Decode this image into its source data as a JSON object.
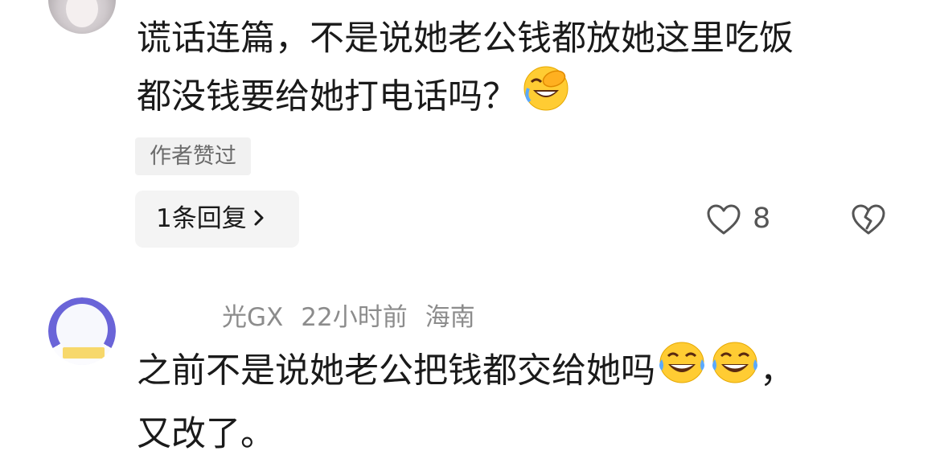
{
  "comment1": {
    "text_line1": "谎话连篇，不是说她老公钱都放她这里吃饭",
    "text_line2": "都没钱要给她打电话吗？",
    "emoji": "face-with-hand-over-eyes-laughing",
    "author_liked_badge": "作者赞过",
    "reply_button_label": "1条回复",
    "like_count": "8"
  },
  "comment2": {
    "username_visible": "光GX",
    "time": "22小时前",
    "location": "海南",
    "text_line1": "之前不是说她老公把钱都交给她吗",
    "text_line1_suffix": "，",
    "text_line2": "又改了。",
    "emoji": "face-with-tears-of-joy"
  },
  "icons": {
    "like": "heart-outline-icon",
    "dislike": "broken-heart-outline-icon",
    "chevron": "chevron-right-icon"
  },
  "colors": {
    "text_primary": "#1a1a1a",
    "text_secondary": "#8c8c8c",
    "badge_bg": "#f1f1f1",
    "emoji_yellow": "#ffcc33"
  }
}
